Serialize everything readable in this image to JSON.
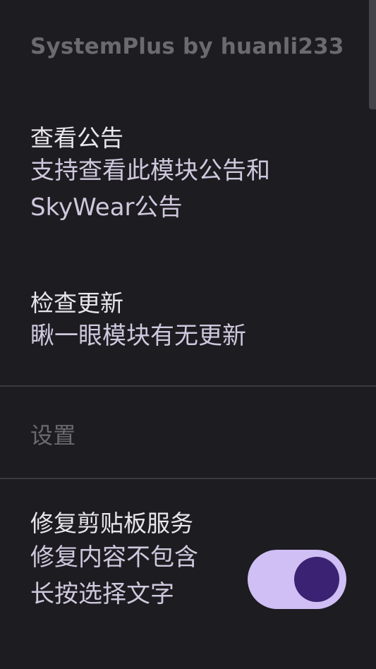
{
  "header": {
    "title": "SystemPlus by huanli233"
  },
  "items": {
    "notice": {
      "title": "查看公告",
      "summary": "支持查看此模块公告和SkyWear公告"
    },
    "update": {
      "title": "检查更新",
      "summary": "瞅一眼模块有无更新"
    }
  },
  "settings": {
    "title": "设置",
    "clipboard": {
      "title": "修复剪贴板服务",
      "summary": "修复内容不包含长按选择文字",
      "enabled": true
    }
  },
  "colors": {
    "background": "#1d1c21",
    "accent": "#cfbff4",
    "thumb": "#3b2272"
  }
}
